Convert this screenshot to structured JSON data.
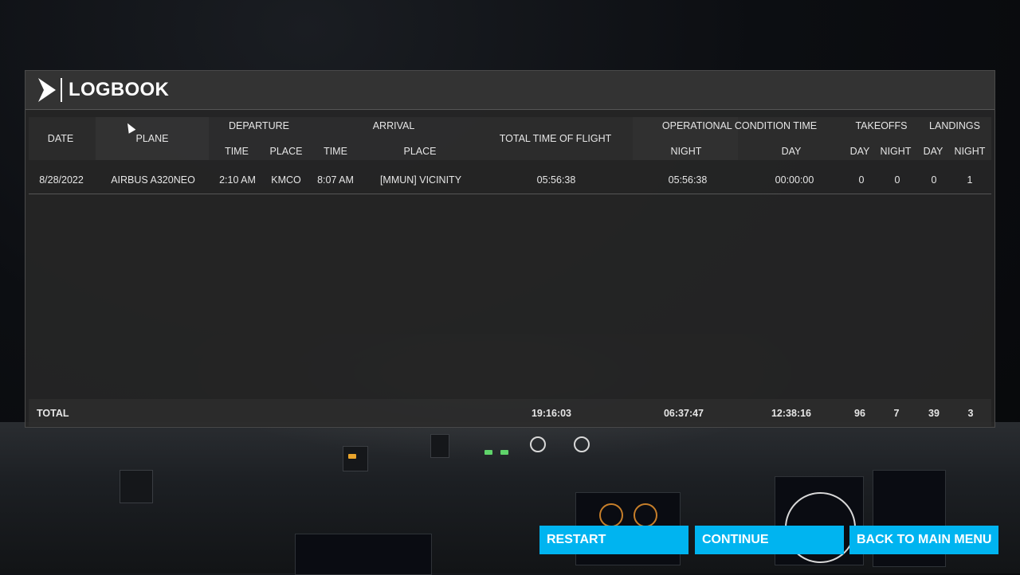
{
  "logbook": {
    "title": "LOGBOOK",
    "headers": {
      "date": "DATE",
      "plane": "PLANE",
      "departure": "DEPARTURE",
      "arrival": "ARRIVAL",
      "dep_time": "TIME",
      "dep_place": "PLACE",
      "arr_time": "TIME",
      "arr_place": "PLACE",
      "total_time": "TOTAL TIME OF FLIGHT",
      "op_condition": "OPERATIONAL CONDITION TIME",
      "op_night": "NIGHT",
      "op_day": "DAY",
      "takeoffs": "TAKEOFFS",
      "landings": "LANDINGS",
      "to_day": "DAY",
      "to_night": "NIGHT",
      "ld_day": "DAY",
      "ld_night": "NIGHT"
    },
    "rows": [
      {
        "date": "8/28/2022",
        "plane": "AIRBUS A320NEO",
        "dep_time": "2:10 AM",
        "dep_place": "KMCO",
        "arr_time": "8:07 AM",
        "arr_place": "[MMUN] VICINITY",
        "total_time": "05:56:38",
        "night": "05:56:38",
        "day": "00:00:00",
        "takeoffs_day": "0",
        "takeoffs_night": "0",
        "landings_day": "0",
        "landings_night": "1"
      }
    ],
    "total": {
      "label": "TOTAL",
      "total_time": "19:16:03",
      "night": "06:37:47",
      "day": "12:38:16",
      "takeoffs_day": "96",
      "takeoffs_night": "7",
      "landings_day": "39",
      "landings_night": "3"
    }
  },
  "buttons": {
    "restart": "RESTART",
    "continue": "CONTINUE",
    "main_menu": "BACK TO MAIN MENU"
  },
  "colors": {
    "accent": "#00b4f0",
    "panel": "#262626"
  }
}
